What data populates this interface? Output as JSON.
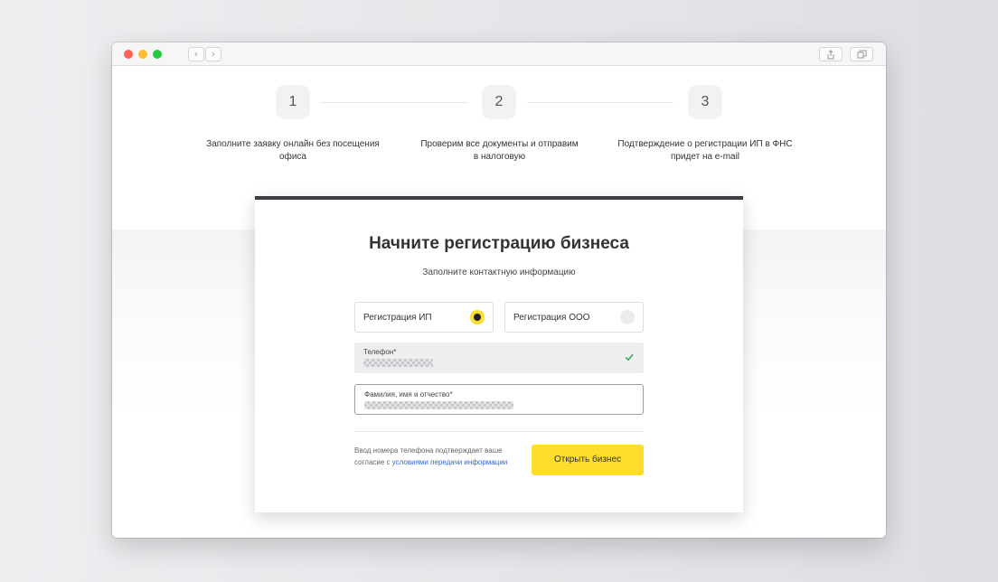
{
  "browser": {
    "back_glyph": "‹",
    "forward_glyph": "›"
  },
  "steps": [
    {
      "number": "1",
      "text": "Заполните заявку онлайн без посещения офиса"
    },
    {
      "number": "2",
      "text": "Проверим все документы и отправим в налоговую"
    },
    {
      "number": "3",
      "text": "Подтверждение о регистрации ИП в ФНС придет на e-mail"
    }
  ],
  "form": {
    "title": "Начните регистрацию бизнеса",
    "subtitle": "Заполните контактную информацию",
    "options": [
      {
        "label": "Регистрация ИП",
        "selected": true
      },
      {
        "label": "Регистрация ООО",
        "selected": false
      }
    ],
    "phone": {
      "label": "Телефон*"
    },
    "fio": {
      "label": "Фамилия, имя и отчество*"
    },
    "consent_text": "Ввод номера телефона подтверждает ваше согласие с ",
    "consent_link": "условиями передачи информации",
    "submit_label": "Открыть бизнес"
  },
  "colors": {
    "accent": "#ffdd2d",
    "card_top": "#3b3e44",
    "link": "#3368c8",
    "check": "#27a844"
  }
}
